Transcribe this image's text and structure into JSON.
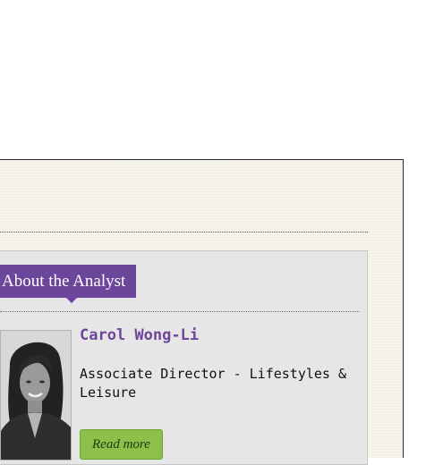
{
  "analyst_section": {
    "heading": "About the Analyst",
    "analyst": {
      "name": "Carol Wong-Li",
      "title": "Associate Director - Lifestyles & Leisure",
      "photo_alt": "Carol Wong-Li"
    },
    "read_more_label": "Read more"
  },
  "colors": {
    "accent_purple": "#6c469a",
    "button_green": "#8cc04a",
    "panel_background": "#e6e6e6",
    "page_background": "#f7f5ec"
  }
}
